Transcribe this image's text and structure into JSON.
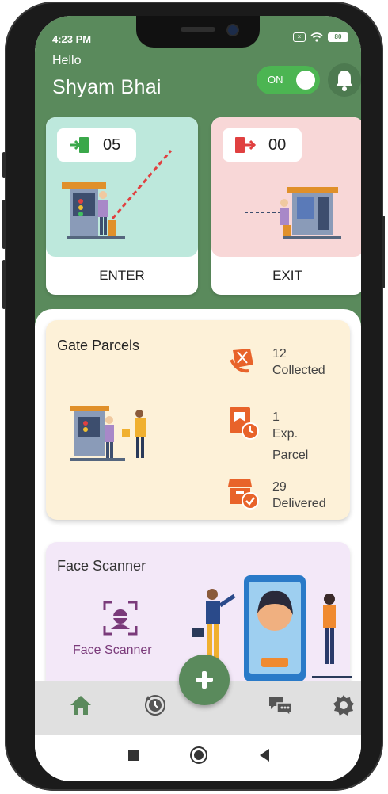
{
  "status_bar": {
    "time": "4:23 PM",
    "battery": "80"
  },
  "header": {
    "greeting": "Hello",
    "username": "Shyam Bhai",
    "toggle_label": "ON"
  },
  "gate": {
    "enter": {
      "count": "05",
      "label": "ENTER"
    },
    "exit": {
      "count": "00",
      "label": "EXIT"
    }
  },
  "parcels": {
    "title": "Gate Parcels",
    "stats": [
      {
        "value": "12",
        "label": "Collected"
      },
      {
        "value": "1",
        "label": "Exp.",
        "label2": "Parcel"
      },
      {
        "value": "29",
        "label": "Delivered"
      }
    ]
  },
  "face_scanner": {
    "title": "Face Scanner",
    "button_label": "Face Scanner"
  },
  "nav": {
    "items": [
      "home-icon",
      "history-icon",
      "chat-icon",
      "settings-icon"
    ],
    "fab_icon": "plus-icon"
  },
  "colors": {
    "brand_green": "#5a8a5c",
    "enter_bg": "#bde8dc",
    "exit_bg": "#f8d7d7",
    "parcel_bg": "#fdf1d8",
    "face_bg": "#f3e8f8",
    "accent_orange": "#e8632a"
  }
}
